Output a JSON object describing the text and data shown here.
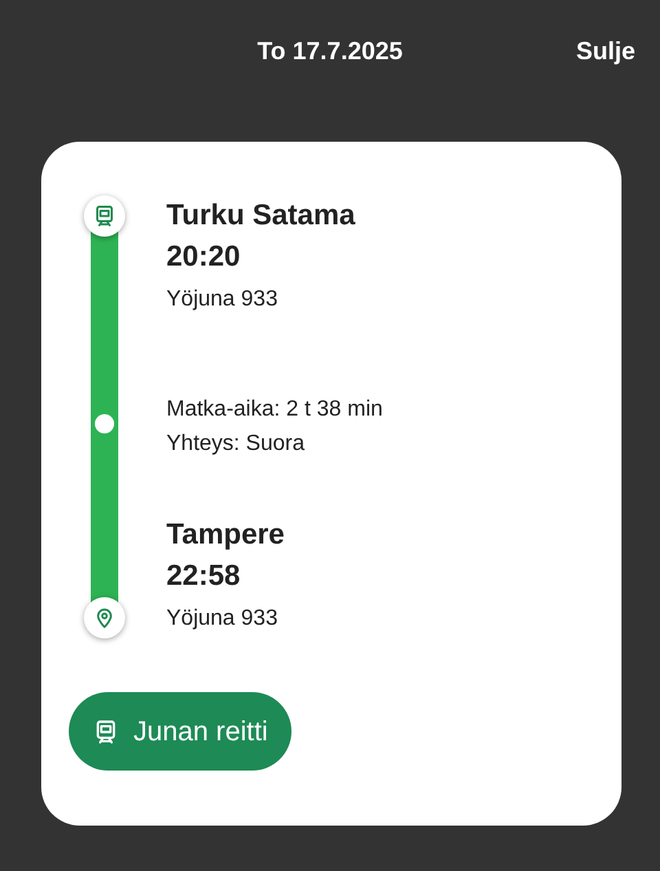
{
  "header": {
    "title": "To 17.7.2025",
    "close": "Sulje"
  },
  "stops": [
    {
      "kind": "origin",
      "name": "Turku Satama",
      "time": "20:20",
      "train": "Yöjuna 933"
    },
    {
      "kind": "destination",
      "name": "Tampere",
      "time": "22:58",
      "train": "Yöjuna 933"
    }
  ],
  "info": [
    "Matka-aika: 2 t 38 min",
    "Yhteys: Suora"
  ],
  "button": {
    "label": "Junan reitti"
  }
}
